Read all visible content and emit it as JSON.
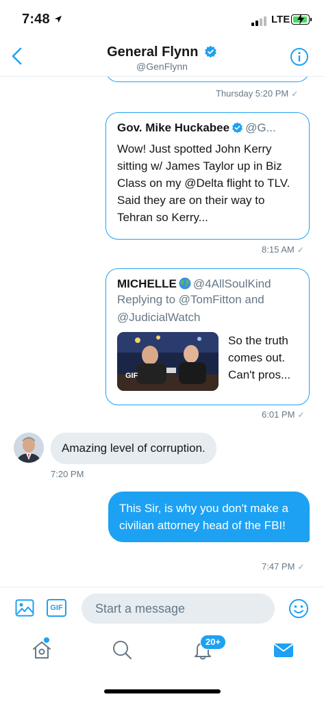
{
  "status_bar": {
    "time": "7:48",
    "network": "LTE"
  },
  "header": {
    "name": "General Flynn",
    "handle": "@GenFlynn"
  },
  "messages": [
    {
      "type": "card_stub",
      "timestamp": "Thursday 5:20 PM"
    },
    {
      "type": "tweet_card",
      "author_name": "Gov. Mike Huckabee",
      "author_handle": "@G...",
      "verified": true,
      "text": "Wow!  Just spotted John Kerry sitting w/ James Taylor up in Biz Class on my @Delta flight to TLV.  Said they are on their way to Tehran so Kerry...",
      "timestamp": "8:15 AM"
    },
    {
      "type": "tweet_card_gif",
      "author_name": "MICHELLE",
      "author_handle": "@4AllSoulKind",
      "reply_to": "Replying to @TomFitton and @JudicialWatch",
      "gif_label": "GIF",
      "text": "So the truth comes out. Can't pros...",
      "timestamp": "6:01 PM"
    },
    {
      "type": "received",
      "text": "Amazing level of corruption.",
      "timestamp": "7:20 PM"
    },
    {
      "type": "sent",
      "text": "This Sir, is why you don't make a civilian attorney head of the FBI!",
      "timestamp": "7:47 PM"
    }
  ],
  "composer": {
    "gif_button": "GIF",
    "placeholder": "Start a message"
  },
  "tabbar": {
    "notifications_badge": "20+"
  },
  "colors": {
    "accent": "#1da1f2",
    "received_bubble": "#e6ecf0",
    "secondary_text": "#657786"
  }
}
